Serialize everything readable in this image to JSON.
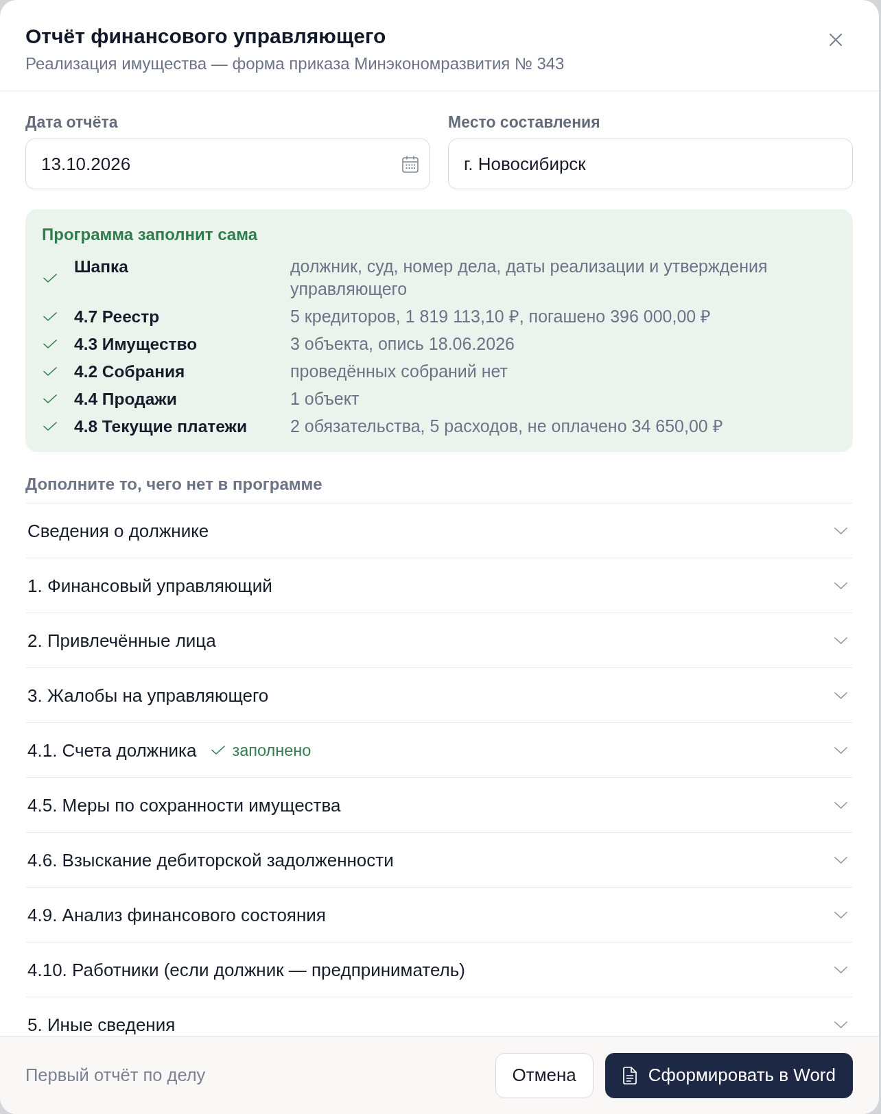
{
  "dialog": {
    "title": "Отчёт финансового управляющего",
    "subtitle": "Реализация имущества — форма приказа Минэкономразвития № 343"
  },
  "fields": [
    {
      "kind": "date",
      "label": "Дата отчёта",
      "value": "13.10.2026"
    },
    {
      "kind": "text",
      "label": "Место составления",
      "value": "г. Новосибирск"
    }
  ],
  "auto_fill": {
    "title": "Программа заполнит сама",
    "items": [
      {
        "label": "Шапка",
        "description": "должник, суд, номер дела, даты реализации и утверждения управляющего",
        "done": true
      },
      {
        "label": "4.7 Реестр",
        "description": "5 кредиторов, 1 819 113,10 ₽, погашено 396 000,00 ₽",
        "done": true
      },
      {
        "label": "4.3 Имущество",
        "description": "3 объекта, опись 18.06.2026",
        "done": true
      },
      {
        "label": "4.2 Собрания",
        "description": "проведённых собраний нет",
        "done": true
      },
      {
        "label": "4.4 Продажи",
        "description": "1 объект",
        "done": true
      },
      {
        "label": "4.8 Текущие платежи",
        "description": "2 обязательства, 5 расходов, не оплачено 34 650,00 ₽",
        "done": true
      }
    ]
  },
  "sections": {
    "heading": "Дополните то, чего нет в программе",
    "items": [
      {
        "label": "Сведения о должнике",
        "expanded": false
      },
      {
        "label": "1. Финансовый управляющий",
        "expanded": false
      },
      {
        "label": "2. Привлечённые лица",
        "expanded": false
      },
      {
        "label": "3. Жалобы на управляющего",
        "expanded": false
      },
      {
        "label": "4.1. Счета должника",
        "expanded": false,
        "status": "заполнено"
      },
      {
        "label": "4.5. Меры по сохранности имущества",
        "expanded": false
      },
      {
        "label": "4.6. Взыскание дебиторской задолженности",
        "expanded": false
      },
      {
        "label": "4.9. Анализ финансового состояния",
        "expanded": false
      },
      {
        "label": "4.10. Работники (если должник — предприниматель)",
        "expanded": false
      },
      {
        "label": "5. Иные сведения",
        "expanded": false
      }
    ]
  },
  "footer": {
    "note": "Первый отчёт по делу",
    "buttons": [
      {
        "kind": "secondary",
        "label": "Отмена"
      },
      {
        "kind": "primary",
        "label": "Сформировать в Word"
      }
    ]
  }
}
